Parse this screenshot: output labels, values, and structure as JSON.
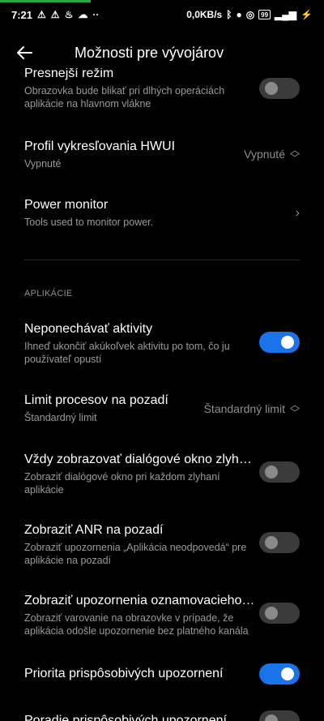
{
  "status": {
    "time": "7:21",
    "network_speed": "0,0KB/s",
    "battery": "99",
    "icons": [
      "warning-icon",
      "warning-icon",
      "flame-icon",
      "cloud-icon",
      "dots-icon",
      "bluetooth-icon",
      "vpn-icon",
      "circle-icon",
      "battery-icon",
      "signal-icon",
      "charging-icon"
    ]
  },
  "header": {
    "title": "Možnosti pre vývojárov"
  },
  "items": [
    {
      "id": "presnejsi",
      "title": "Presnejší režim",
      "subtitle": "Obrazovka bude blikať pri dlhých operáciách aplikácie na hlavnom vlákne",
      "toggle": "off"
    },
    {
      "id": "hwui",
      "title": "Profil vykresľovania HWUI",
      "subtitle": "Vypnuté",
      "value": "Vypnuté"
    },
    {
      "id": "power",
      "title": "Power monitor",
      "subtitle": "Tools used to monitor power."
    },
    {
      "id": "neponechavat",
      "title": "Neponechávať aktivity",
      "subtitle": "Ihneď ukončiť akúkoľvek aktivitu po tom, čo ju používateľ opustí",
      "toggle": "on"
    },
    {
      "id": "limit",
      "title": "Limit procesov na pozadí",
      "subtitle": "Štandardný limit",
      "value": "Štandardný limit"
    },
    {
      "id": "dialog",
      "title": "Vždy zobrazovať dialógové okno zlyhania",
      "subtitle": "Zobraziť dialógové okno pri každom zlyhaní aplikácie",
      "toggle": "off"
    },
    {
      "id": "anr",
      "title": "Zobraziť ANR na pozadí",
      "subtitle": "Zobraziť upozornenia „Aplikácia neodpovedá“ pre aplikácie na pozadí",
      "toggle": "off"
    },
    {
      "id": "channel",
      "title": "Zobraziť upozornenia oznamovacieho kanála",
      "subtitle": "Zobraziť varovanie na obrazovke v prípade, že aplikácia odošle upozornenie bez platného kanála",
      "toggle": "off"
    },
    {
      "id": "priorita",
      "title": "Priorita prispôsobivých upozornení",
      "toggle": "on"
    },
    {
      "id": "poradie",
      "title": "Poradie prispôsobivých upozornení",
      "toggle": "off"
    }
  ],
  "sections": {
    "apps": "APLIKÁCIE"
  },
  "colors": {
    "accent": "#1a73e8",
    "background": "#000000",
    "progress": "#28a745"
  }
}
